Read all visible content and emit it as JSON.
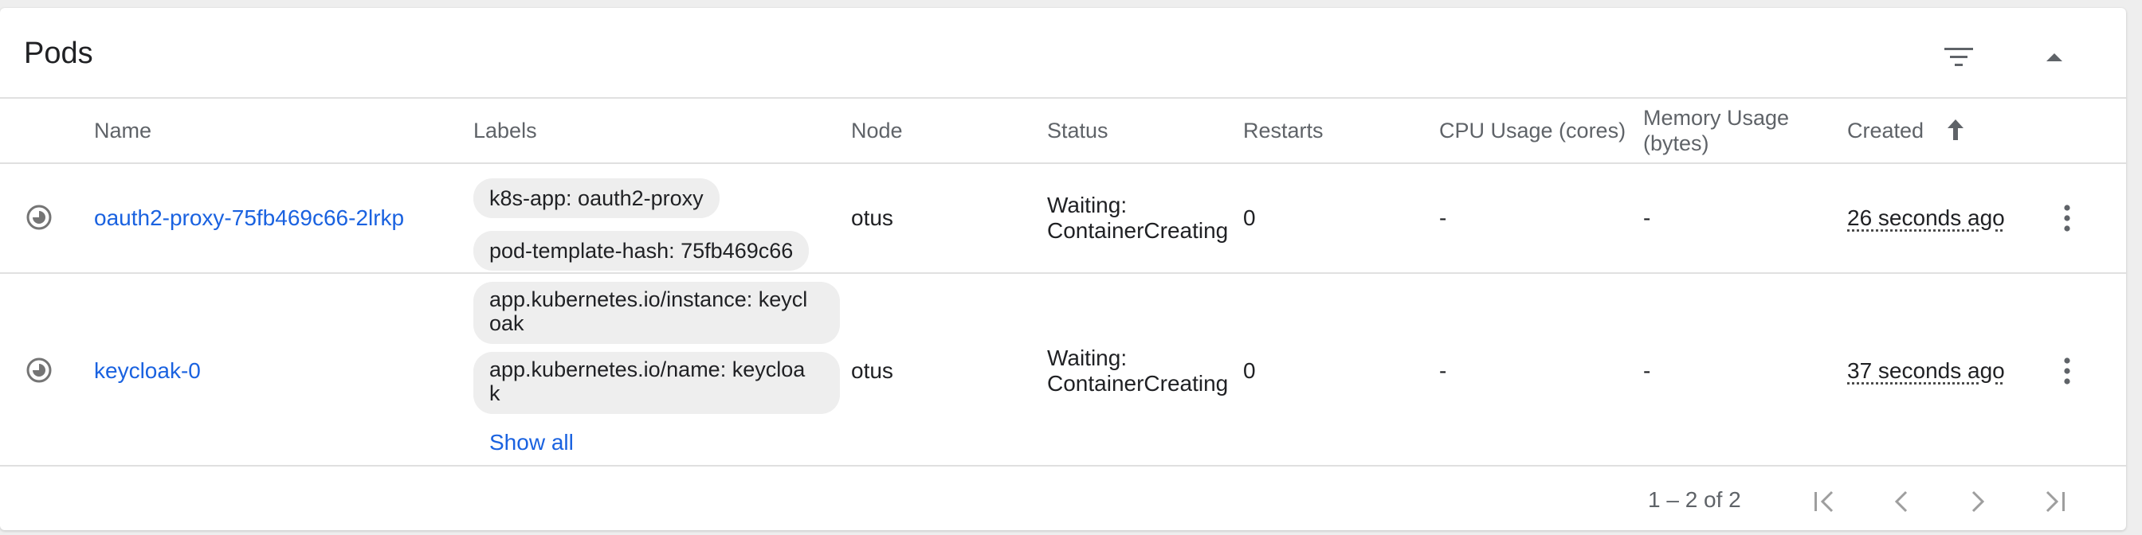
{
  "card": {
    "title": "Pods",
    "filter_icon": "filter-list-icon",
    "collapse_icon": "expand-less-icon"
  },
  "columns": {
    "name": "Name",
    "labels": "Labels",
    "node": "Node",
    "status": "Status",
    "restarts": "Restarts",
    "cpu": "CPU Usage (cores)",
    "memory_line1": "Memory Usage",
    "memory_line2": "(bytes)",
    "created": "Created",
    "created_sort_icon": "arrow-upward-icon"
  },
  "rows": [
    {
      "status_icon": "pending-icon",
      "name": "oauth2-proxy-75fb469c66-2lrkp",
      "labels": [
        "k8s-app: oauth2-proxy",
        "pod-template-hash: 75fb469c66"
      ],
      "node": "otus",
      "status_line1": "Waiting:",
      "status_line2": "ContainerCreating",
      "restarts": "0",
      "cpu": "-",
      "memory": "-",
      "created": "26 seconds ago",
      "menu_icon": "more-vert-icon"
    },
    {
      "status_icon": "pending-icon",
      "name": "keycloak-0",
      "labels": [
        "app.kubernetes.io/instance: keycl oak",
        "app.kubernetes.io/name: keycloa k"
      ],
      "labels_display": {
        "l1_line1": "app.kubernetes.io/instance: keycl",
        "l1_line2": "oak",
        "l2_line1": "app.kubernetes.io/name: keycloa",
        "l2_line2": "k"
      },
      "show_all": "Show all",
      "node": "otus",
      "status_line1": "Waiting:",
      "status_line2": "ContainerCreating",
      "restarts": "0",
      "cpu": "-",
      "memory": "-",
      "created": "37 seconds ago",
      "menu_icon": "more-vert-icon"
    }
  ],
  "pagination": {
    "range": "1 – 2 of 2",
    "first_icon": "first-page-icon",
    "prev_icon": "chevron-left-icon",
    "next_icon": "chevron-right-icon",
    "last_icon": "last-page-icon"
  },
  "colors": {
    "link": "#1a62e0",
    "chip": "#eeeeee",
    "header_text": "#5f6368"
  }
}
